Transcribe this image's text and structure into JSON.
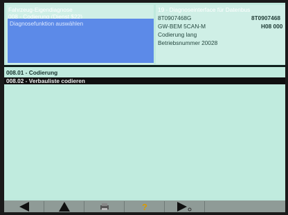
{
  "header_left": {
    "rows": [
      "Fahrzeug-Eigendiagnose",
      "008 - Codierung (Dienst $22)",
      "Diagnosefunktion auswählen"
    ]
  },
  "header_right": {
    "rows": [
      "19 - Diagnoseinterface für Datenbus",
      "8T0907468G",
      "GW-BEM 5CAN-M",
      "Codierung lang",
      "Betriebsnummer 20028"
    ],
    "part_number_right": "8T0907468",
    "version": "H08 000"
  },
  "function_list": [
    "008.01 - Codierung",
    "008.02 - Verbauliste codieren"
  ],
  "toolbar": {
    "buttons": [
      "back-icon",
      "up-icon",
      "print-icon",
      "help-icon",
      "forward-icon"
    ]
  },
  "colors": {
    "screen_bg": "#bfe9dd",
    "selection": "#5c8ae8",
    "list_highlight": "#101010"
  }
}
